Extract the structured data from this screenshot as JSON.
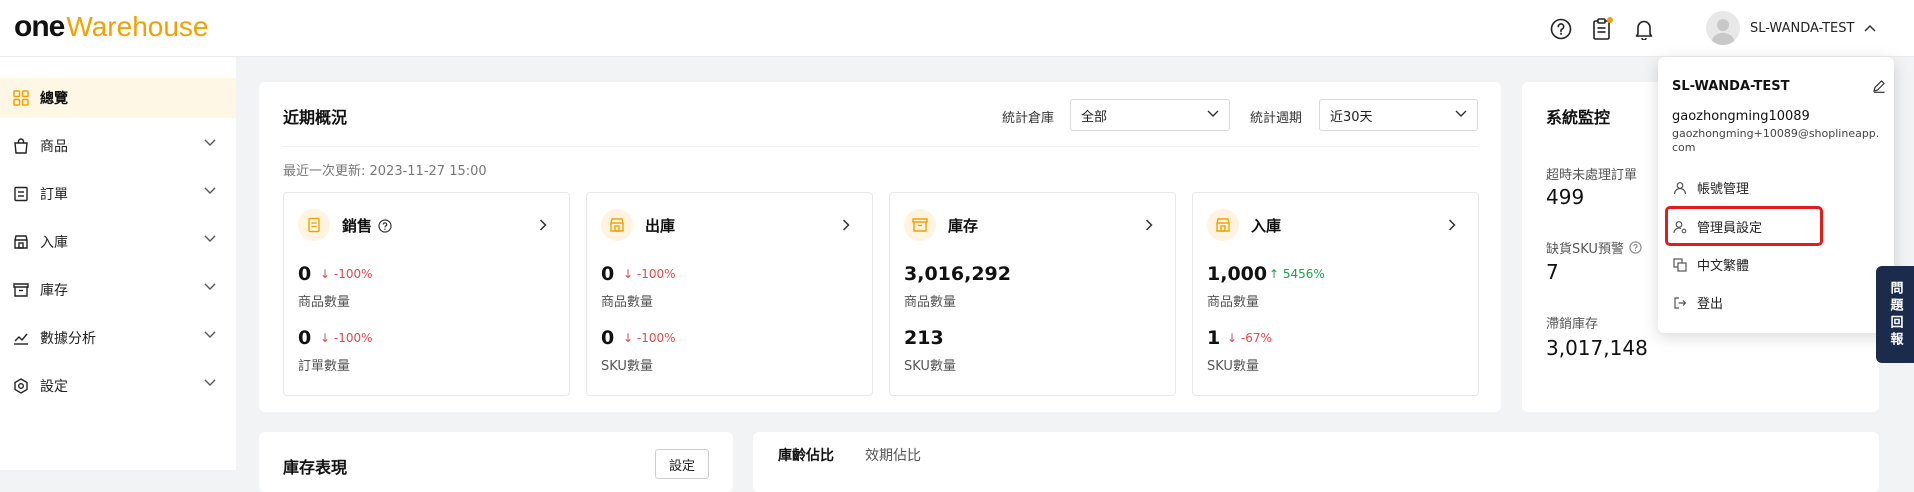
{
  "header": {
    "logo_one": "one",
    "logo_warehouse": "Warehouse",
    "username": "SL-WANDA-TEST"
  },
  "sidebar": {
    "items": [
      {
        "label": "總覽"
      },
      {
        "label": "商品"
      },
      {
        "label": "訂單"
      },
      {
        "label": "入庫"
      },
      {
        "label": "庫存"
      },
      {
        "label": "數據分析"
      },
      {
        "label": "設定"
      }
    ]
  },
  "overview": {
    "title": "近期概況",
    "warehouse_label": "統計倉庫",
    "warehouse_value": "全部",
    "period_label": "統計週期",
    "period_value": "近30天",
    "last_update": "最近一次更新: 2023-11-27 15:00",
    "cards": [
      {
        "name": "銷售",
        "v1": "0",
        "d1": "-100%",
        "l1": "商品數量",
        "v2": "0",
        "d2": "-100%",
        "l2": "訂單數量"
      },
      {
        "name": "出庫",
        "v1": "0",
        "d1": "-100%",
        "l1": "商品數量",
        "v2": "0",
        "d2": "-100%",
        "l2": "SKU數量"
      },
      {
        "name": "庫存",
        "v1": "3,016,292",
        "d1": "",
        "l1": "商品數量",
        "v2": "213",
        "d2": "",
        "l2": "SKU數量"
      },
      {
        "name": "入庫",
        "v1": "1,000",
        "d1": "5456%",
        "l1": "商品數量",
        "v2": "1",
        "d2": "-67%",
        "l2": "SKU數量"
      }
    ]
  },
  "monitor": {
    "title": "系統監控",
    "items": [
      {
        "label": "超時未處理訂單",
        "value": "499"
      },
      {
        "label": "缺貨SKU預警",
        "value": "7"
      },
      {
        "label": "滯銷庫存",
        "value": "3,017,148"
      }
    ]
  },
  "bottom": {
    "inventory_title": "庫存表現",
    "settings_button": "設定",
    "tab_age": "庫齡佔比",
    "tab_expiry": "效期佔比"
  },
  "dropdown": {
    "username": "SL-WANDA-TEST",
    "account": "gaozhongming10089",
    "email": "gaozhongming+10089@shoplineapp.com",
    "items": [
      {
        "label": "帳號管理"
      },
      {
        "label": "管理員設定"
      },
      {
        "label": "中文繁體"
      },
      {
        "label": "登出"
      }
    ]
  },
  "feedback": "問題回報",
  "colors": {
    "accent": "#f4a100",
    "down": "#e5484d",
    "up": "#17a34a",
    "highlight": "#e21b1b"
  }
}
